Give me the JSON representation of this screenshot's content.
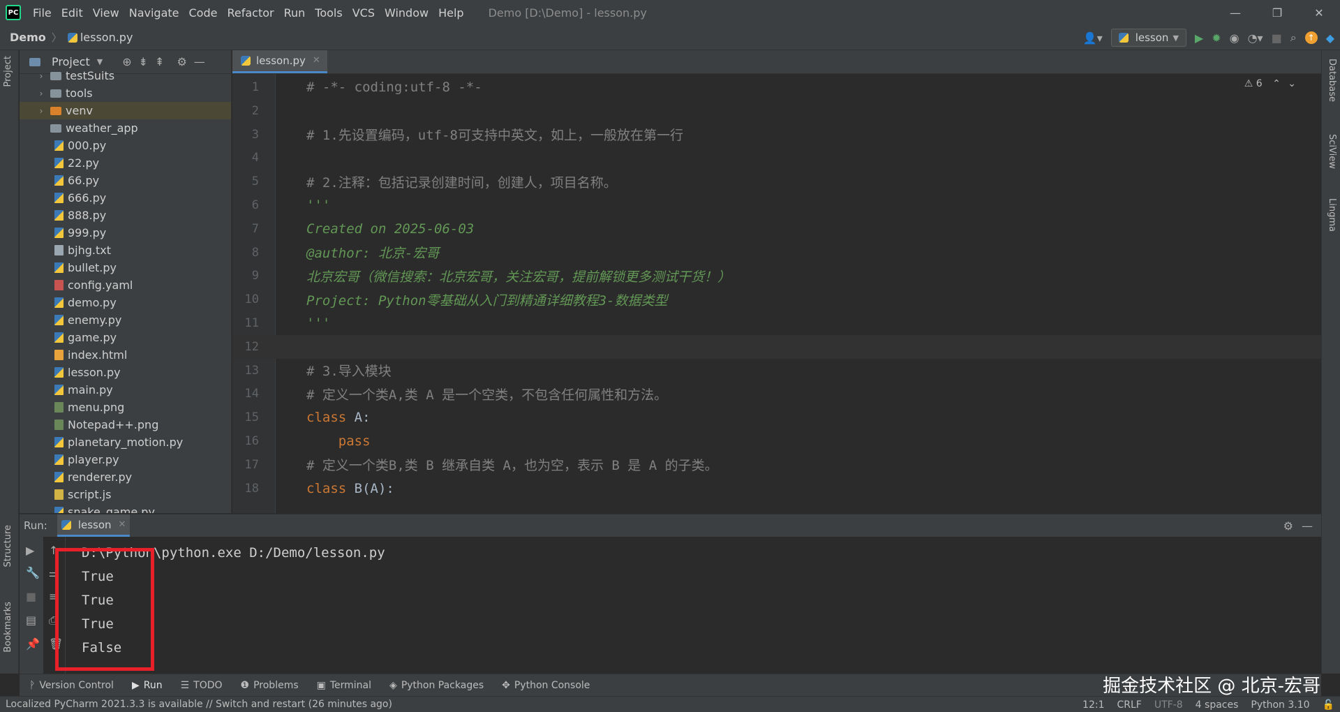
{
  "menubar": {
    "items": [
      "File",
      "Edit",
      "View",
      "Navigate",
      "Code",
      "Refactor",
      "Run",
      "Tools",
      "VCS",
      "Window",
      "Help"
    ],
    "title": "Demo [D:\\Demo] - lesson.py"
  },
  "navbar": {
    "project": "Demo",
    "file": "lesson.py",
    "run_config": "lesson"
  },
  "project_panel": {
    "title": "Project",
    "items": [
      {
        "name": "testSuits",
        "type": "folder"
      },
      {
        "name": "tools",
        "type": "folder"
      },
      {
        "name": "venv",
        "type": "venv"
      },
      {
        "name": "weather_app",
        "type": "folder"
      },
      {
        "name": "000.py",
        "type": "py"
      },
      {
        "name": "22.py",
        "type": "py"
      },
      {
        "name": "66.py",
        "type": "py"
      },
      {
        "name": "666.py",
        "type": "py"
      },
      {
        "name": "888.py",
        "type": "py"
      },
      {
        "name": "999.py",
        "type": "py"
      },
      {
        "name": "bjhg.txt",
        "type": "txt"
      },
      {
        "name": "bullet.py",
        "type": "py"
      },
      {
        "name": "config.yaml",
        "type": "yaml"
      },
      {
        "name": "demo.py",
        "type": "py"
      },
      {
        "name": "enemy.py",
        "type": "py"
      },
      {
        "name": "game.py",
        "type": "py"
      },
      {
        "name": "index.html",
        "type": "html"
      },
      {
        "name": "lesson.py",
        "type": "py"
      },
      {
        "name": "main.py",
        "type": "py"
      },
      {
        "name": "menu.png",
        "type": "img"
      },
      {
        "name": "Notepad++.png",
        "type": "img"
      },
      {
        "name": "planetary_motion.py",
        "type": "py"
      },
      {
        "name": "player.py",
        "type": "py"
      },
      {
        "name": "renderer.py",
        "type": "py"
      },
      {
        "name": "script.js",
        "type": "js"
      },
      {
        "name": "snake_game.py",
        "type": "py"
      }
    ]
  },
  "editor": {
    "tab": "lesson.py",
    "warnings": "6",
    "current_line": 12,
    "lines": [
      {
        "n": "1",
        "text": "# -*- coding:utf-8 -*-",
        "cls": "c-comment"
      },
      {
        "n": "2",
        "text": "",
        "cls": ""
      },
      {
        "n": "3",
        "text": "# 1.先设置编码，utf-8可支持中英文，如上，一般放在第一行",
        "cls": "c-comment"
      },
      {
        "n": "4",
        "text": "",
        "cls": ""
      },
      {
        "n": "5",
        "text": "# 2.注释：包括记录创建时间，创建人，项目名称。",
        "cls": "c-comment"
      },
      {
        "n": "6",
        "text": "'''",
        "cls": "c-doc"
      },
      {
        "n": "7",
        "text": "Created on 2025-06-03",
        "cls": "c-doc"
      },
      {
        "n": "8",
        "text": "@author: 北京-宏哥",
        "cls": "c-doc"
      },
      {
        "n": "9",
        "text": "北京宏哥（微信搜索：北京宏哥，关注宏哥，提前解锁更多测试干货！）",
        "cls": "c-doc"
      },
      {
        "n": "10",
        "text": "Project: Python零基础从入门到精通详细教程3-数据类型",
        "cls": "c-doc"
      },
      {
        "n": "11",
        "text": "'''",
        "cls": "c-doc"
      },
      {
        "n": "12",
        "text": "",
        "cls": ""
      },
      {
        "n": "13",
        "text": "# 3.导入模块",
        "cls": "c-comment"
      },
      {
        "n": "14",
        "text": "# 定义一个类A,类 A 是一个空类，不包含任何属性和方法。",
        "cls": "c-comment"
      },
      {
        "n": "15",
        "kw": "class",
        "rest": " A:",
        "cls": "c-def"
      },
      {
        "n": "16",
        "kw": "    pass",
        "rest": "",
        "cls": "c-def"
      },
      {
        "n": "17",
        "text": "# 定义一个类B,类 B 继承自类 A，也为空，表示 B 是 A 的子类。",
        "cls": "c-comment"
      },
      {
        "n": "18",
        "kw": "class",
        "rest": " B(A):",
        "cls": "c-def"
      }
    ]
  },
  "run_panel": {
    "label": "Run:",
    "tab": "lesson",
    "output": [
      "D:\\Python\\python.exe D:/Demo/lesson.py",
      "True",
      "True",
      "True",
      "False"
    ]
  },
  "bottom_tools": [
    "Version Control",
    "Run",
    "TODO",
    "Problems",
    "Terminal",
    "Python Packages",
    "Python Console"
  ],
  "side_tools": {
    "left": [
      "Project",
      "Structure",
      "Bookmarks"
    ],
    "right": [
      "Database",
      "SciView",
      "Lingma"
    ]
  },
  "status": {
    "message": "Localized PyCharm 2021.3.3 is available // Switch and restart (26 minutes ago)",
    "position": "12:1",
    "line_sep": "CRLF",
    "encoding": "UTF-8",
    "indent": "4 spaces",
    "interpreter": "Python 3.10"
  },
  "watermark": "掘金技术社区 @ 北京-宏哥"
}
